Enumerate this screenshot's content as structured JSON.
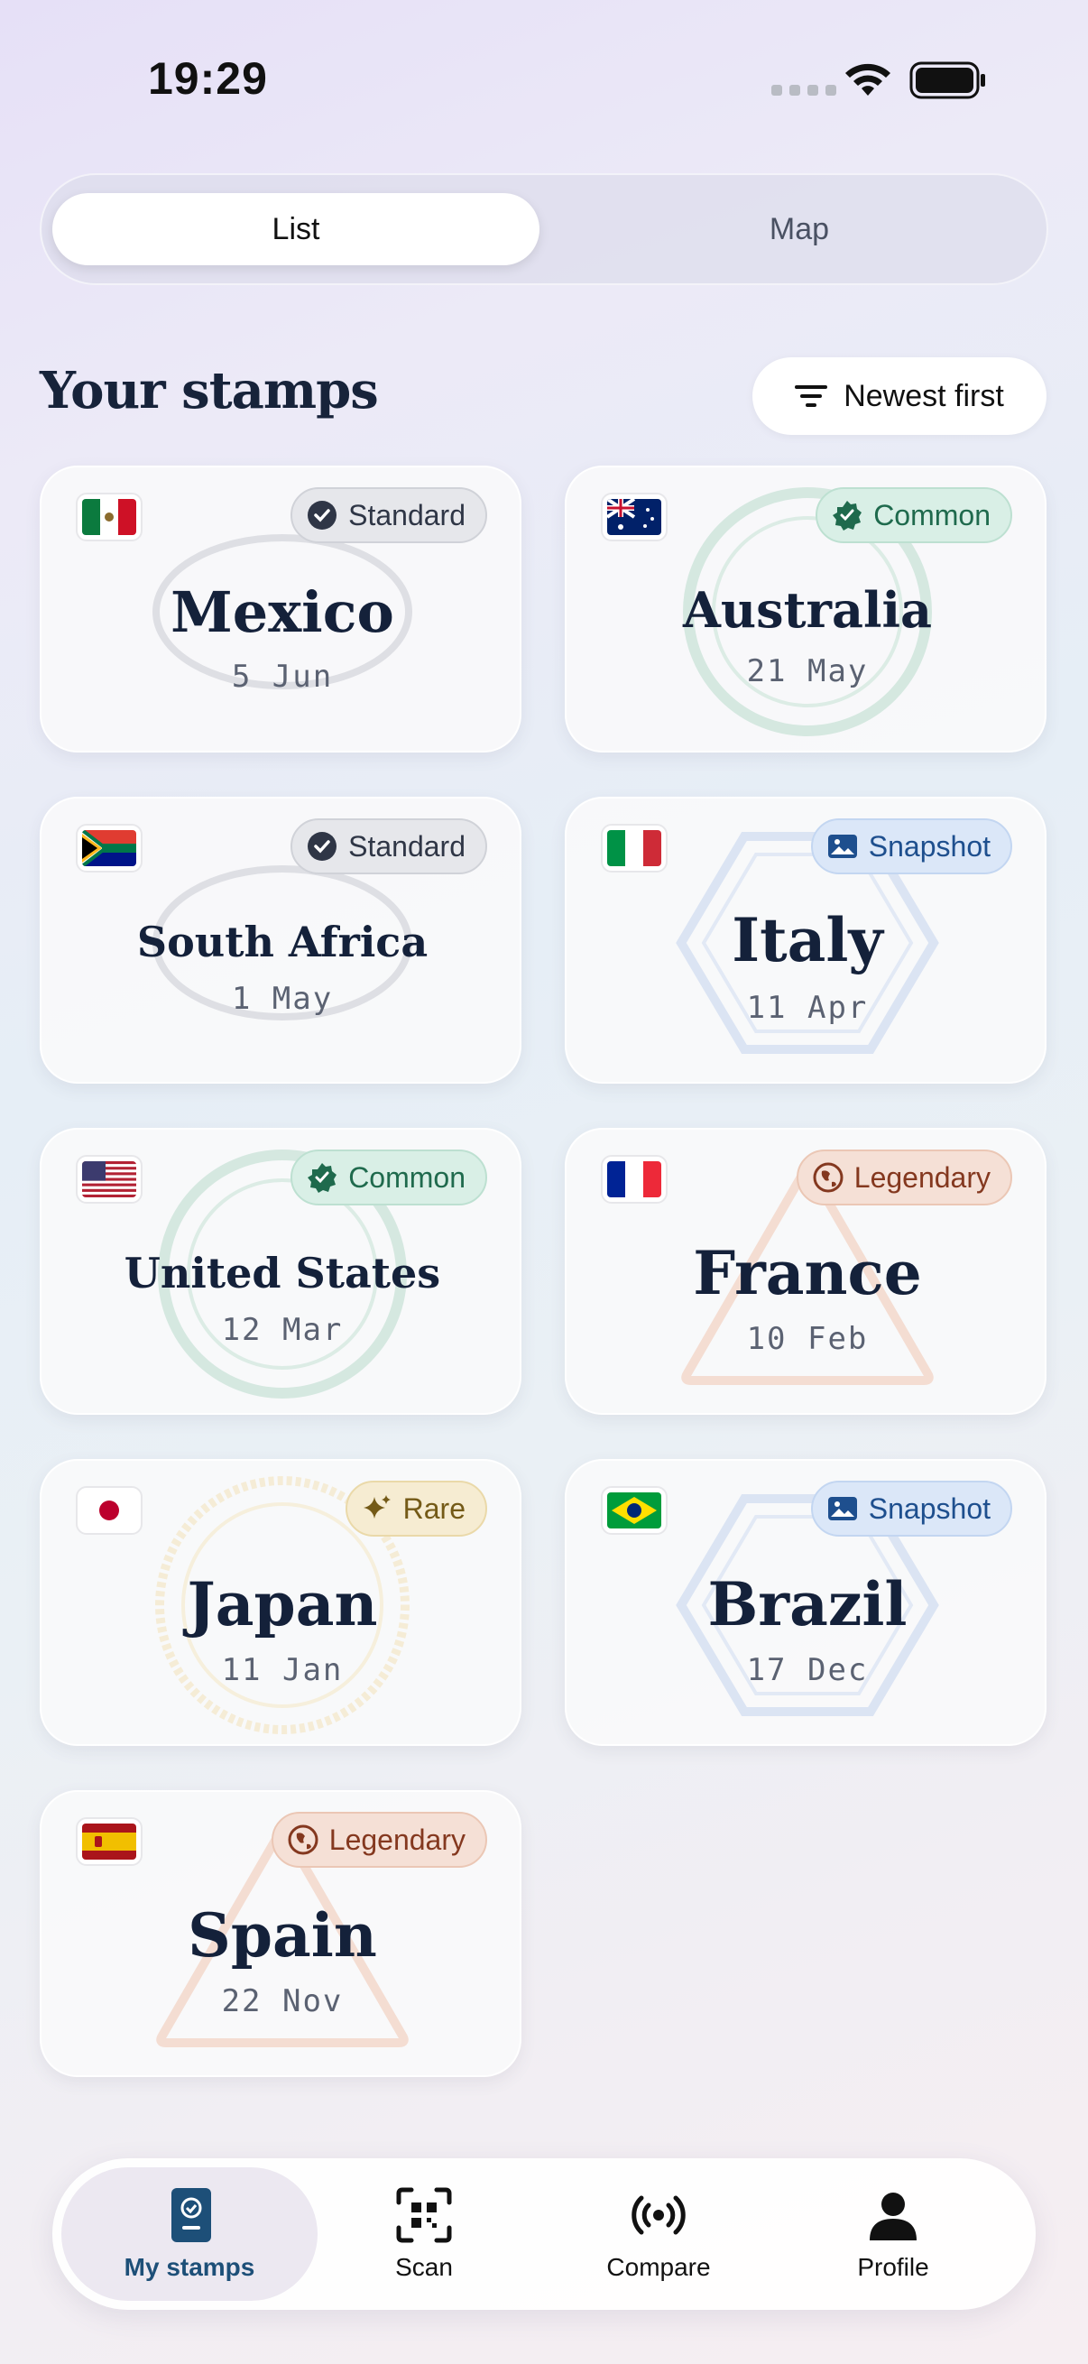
{
  "status": {
    "time": "19:29"
  },
  "view_toggle": {
    "list": "List",
    "map": "Map"
  },
  "header": {
    "title": "Your stamps",
    "sort_label": "Newest first"
  },
  "stamps": [
    {
      "country": "Mexico",
      "date": "5 Jun",
      "badge": "Standard",
      "flag": "mexico-flag"
    },
    {
      "country": "Australia",
      "date": "21 May",
      "badge": "Common",
      "flag": "australia-flag"
    },
    {
      "country": "South Africa",
      "date": "1 May",
      "badge": "Standard",
      "flag": "south-africa-flag"
    },
    {
      "country": "Italy",
      "date": "11 Apr",
      "badge": "Snapshot",
      "flag": "italy-flag"
    },
    {
      "country": "United States",
      "date": "12 Mar",
      "badge": "Common",
      "flag": "usa-flag"
    },
    {
      "country": "France",
      "date": "10 Feb",
      "badge": "Legendary",
      "flag": "france-flag"
    },
    {
      "country": "Japan",
      "date": "11 Jan",
      "badge": "Rare",
      "flag": "japan-flag"
    },
    {
      "country": "Brazil",
      "date": "17 Dec",
      "badge": "Snapshot",
      "flag": "brazil-flag"
    },
    {
      "country": "Spain",
      "date": "22 Nov",
      "badge": "Legendary",
      "flag": "spain-flag"
    }
  ],
  "nav": {
    "my_stamps": "My stamps",
    "scan": "Scan",
    "compare": "Compare",
    "profile": "Profile"
  },
  "colors": {
    "standard": "#e6e7eb",
    "common": "#d9efe6",
    "snapshot": "#dbe7f8",
    "legendary": "#f5e0d6",
    "rare": "#f6ecd2",
    "nav_active": "#1d4f78"
  }
}
